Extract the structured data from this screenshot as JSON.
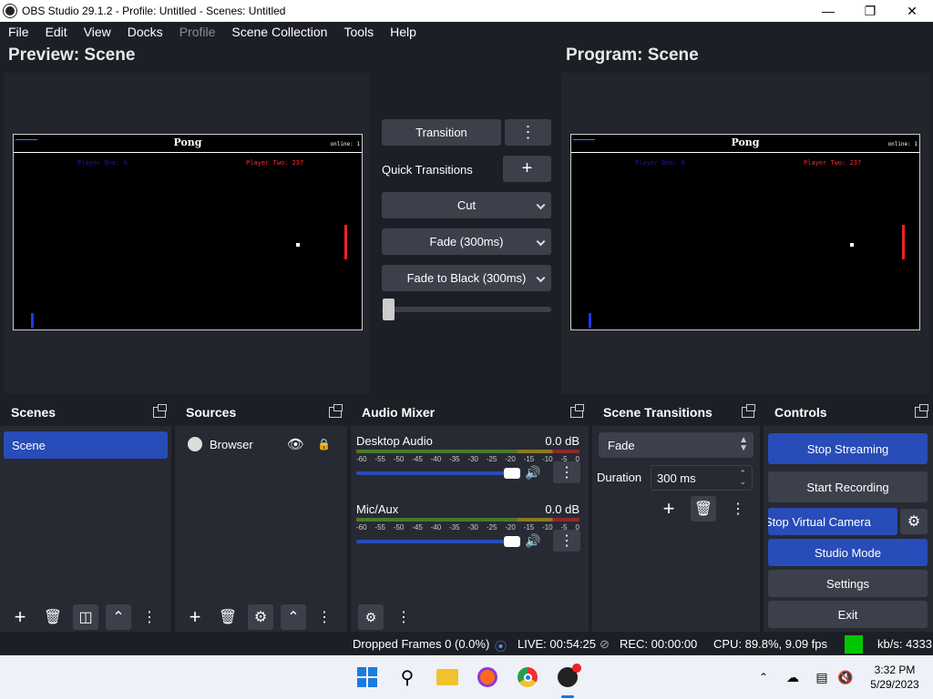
{
  "window": {
    "title": "OBS Studio 29.1.2 - Profile: Untitled - Scenes: Untitled"
  },
  "menu": [
    "File",
    "Edit",
    "View",
    "Docks",
    "Profile",
    "Scene Collection",
    "Tools",
    "Help"
  ],
  "preview": {
    "left_title": "Preview: Scene",
    "right_title": "Program: Scene",
    "game_title": "Pong",
    "online_text": "online: 1",
    "player_one": "Player One: 0",
    "player_two": "Player Two: 237"
  },
  "transitions_panel": {
    "transition_button": "Transition",
    "quick_transitions_label": "Quick Transitions",
    "cut": "Cut",
    "fade": "Fade (300ms)",
    "fade_black": "Fade to Black (300ms)",
    "tbar_fraction": 0.0
  },
  "docks": {
    "scenes": {
      "title": "Scenes",
      "items": [
        "Scene"
      ]
    },
    "sources": {
      "title": "Sources",
      "items": [
        {
          "name": "Browser",
          "visible": true,
          "locked": false
        }
      ]
    },
    "audio": {
      "title": "Audio Mixer",
      "channels": [
        {
          "name": "Desktop Audio",
          "db": "0.0 dB",
          "volume": 1.0
        },
        {
          "name": "Mic/Aux",
          "db": "0.0 dB",
          "volume": 1.0
        }
      ],
      "scale": [
        "-60",
        "-55",
        "-50",
        "-45",
        "-40",
        "-35",
        "-30",
        "-25",
        "-20",
        "-15",
        "-10",
        "-5",
        "0"
      ]
    },
    "scene_transitions": {
      "title": "Scene Transitions",
      "selected": "Fade",
      "duration_label": "Duration",
      "duration_value": "300 ms"
    },
    "controls": {
      "title": "Controls",
      "stop_streaming": "Stop Streaming",
      "start_recording": "Start Recording",
      "stop_virtual_camera": "Stop Virtual Camera",
      "studio_mode": "Studio Mode",
      "settings": "Settings",
      "exit": "Exit"
    }
  },
  "status": {
    "dropped": "Dropped Frames 0 (0.0%)",
    "live": "LIVE: 00:54:25",
    "rec": "REC: 00:00:00",
    "cpu": "CPU: 89.8%, 9.09 fps",
    "kbs": "kb/s: 4333"
  },
  "taskbar": {
    "time": "3:32 PM",
    "date": "5/29/2023"
  },
  "colors": {
    "accent": "#284cb8",
    "background": "#1d1f26",
    "panel": "#272a33",
    "button": "#3c404b",
    "status_ok": "#00c800"
  }
}
